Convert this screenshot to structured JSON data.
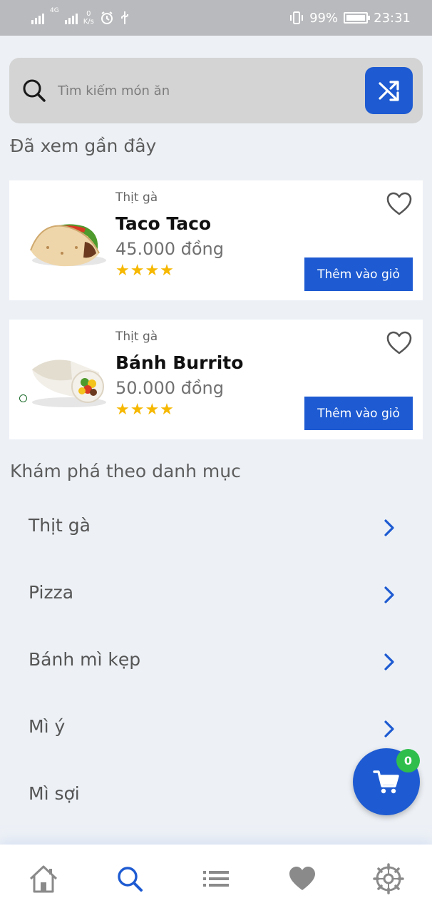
{
  "status_bar": {
    "network": "4G",
    "net_speed_value": "0",
    "net_speed_unit": "K/s",
    "battery": "99%",
    "time": "23:31"
  },
  "search": {
    "placeholder": "Tìm kiếm món ăn",
    "value": ""
  },
  "recent": {
    "title": "Đã xem gần đây",
    "items": [
      {
        "category": "Thịt gà",
        "name": "Taco Taco",
        "price": "45.000 đồng",
        "rating": 4,
        "stars": "★★★★",
        "add_label": "Thêm vào giỏ",
        "image_icon": "taco-icon"
      },
      {
        "category": "Thịt gà",
        "name": "Bánh Burrito",
        "price": "50.000 đồng",
        "rating": 4,
        "stars": "★★★★",
        "add_label": "Thêm vào giỏ",
        "image_icon": "burrito-icon"
      }
    ]
  },
  "categories": {
    "title": "Khám phá theo danh mục",
    "items": [
      {
        "label": "Thịt gà"
      },
      {
        "label": "Pizza"
      },
      {
        "label": "Bánh mì kẹp"
      },
      {
        "label": "Mì ý"
      },
      {
        "label": "Mì sợi"
      }
    ]
  },
  "cart": {
    "count": "0"
  },
  "bottom_nav": {
    "items": [
      {
        "icon": "home-icon",
        "active": false
      },
      {
        "icon": "search-icon",
        "active": true
      },
      {
        "icon": "list-icon",
        "active": false
      },
      {
        "icon": "heart-icon",
        "active": false
      },
      {
        "icon": "settings-icon",
        "active": false
      }
    ]
  },
  "colors": {
    "accent": "#1e5bd2",
    "background": "#edf1f6",
    "star": "#f6b800",
    "badge": "#2fbe4c",
    "nav_inactive": "#8a8a8a"
  }
}
